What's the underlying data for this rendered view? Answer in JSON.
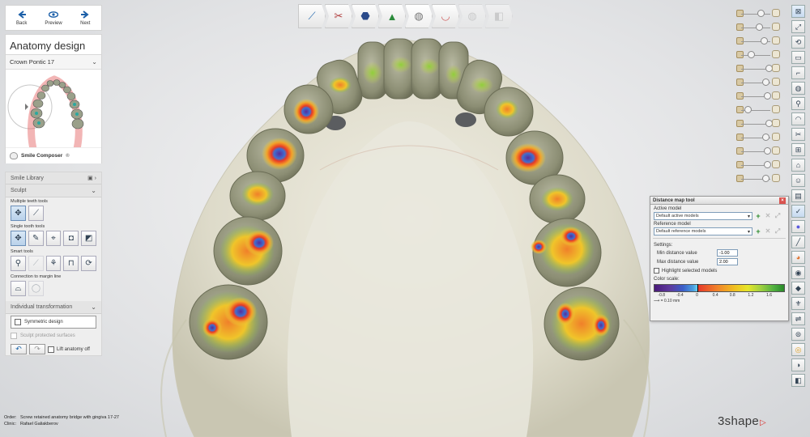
{
  "nav": {
    "back": "Back",
    "preview": "Preview",
    "next": "Next"
  },
  "design": {
    "title": "Anatomy design",
    "subtitle": "Crown Pontic 17",
    "smile_composer": "Smile Composer"
  },
  "tools": {
    "smile_library": "Smile Library",
    "sculpt": "Sculpt",
    "multiple_teeth": "Multiple teeth tools",
    "single_tooth": "Single tooth tools",
    "smart_tools": "Smart tools",
    "connection": "Connection to margin line",
    "individual_transformation": "Individual transformation",
    "symmetric_design": "Symmetric design",
    "sculpt_protected": "Sculpt protected surfaces",
    "lift_anatomy_off": "Lift anatomy off"
  },
  "distance_map": {
    "title": "Distance map tool",
    "active_model_label": "Active model",
    "active_model_value": "Default active models",
    "reference_model_label": "Reference model",
    "reference_model_value": "Default reference models",
    "settings_label": "Settings:",
    "min_label": "Min distance value",
    "min_value": "-1.00",
    "max_label": "Max distance value",
    "max_value": "2.00",
    "highlight_label": "Highlight selected models",
    "color_scale_label": "Color scale:",
    "scale_ticks": [
      "-0.8",
      "-0.4",
      "0",
      "0.4",
      "0.8",
      "1.2",
      "1.6"
    ],
    "scale_note": "= 0.10 mm"
  },
  "footer": {
    "order_label": "Order:",
    "order_value": "Screw retained anatomy bridge with gingiva 17-27",
    "clinic_label": "Clinic:",
    "clinic_value": "Rafael Galiakberov",
    "brand": "3shape"
  },
  "colors": {
    "accent": "#d9302c",
    "active_tool": "#b9d1ea",
    "gingiva": "#e6e4d4",
    "tooth": "#8f9176"
  }
}
